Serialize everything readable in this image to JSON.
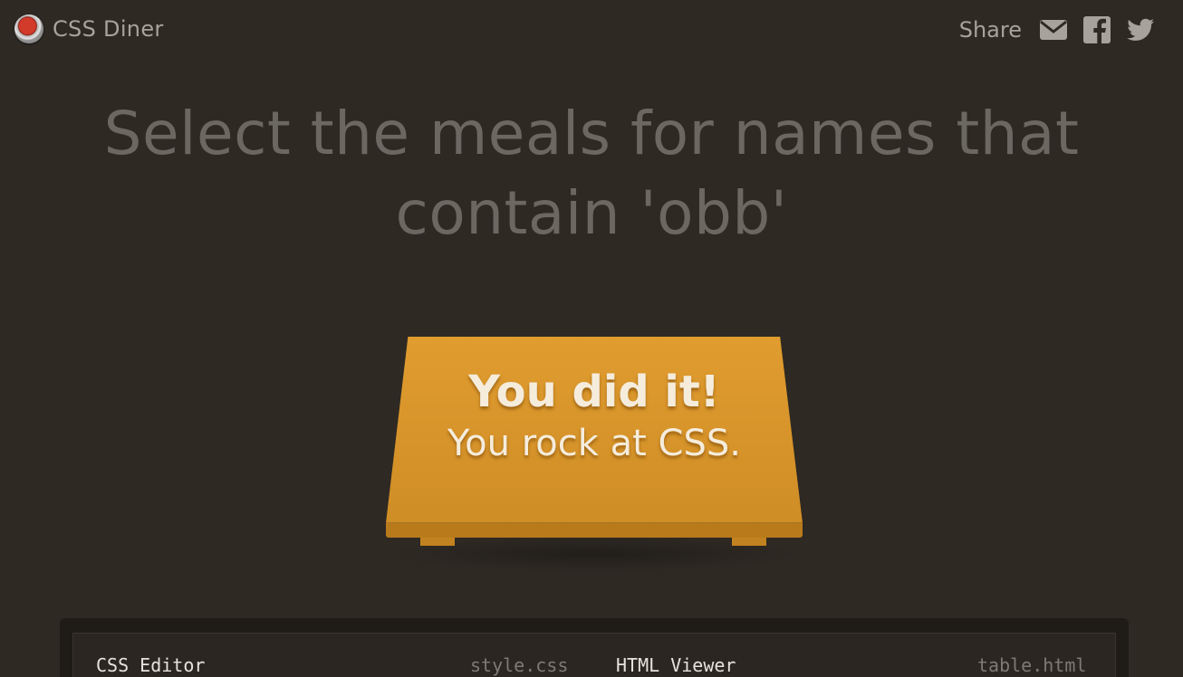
{
  "header": {
    "logo_text": "CSS Diner",
    "share_label": "Share",
    "share_icons": [
      "mail-icon",
      "facebook-icon",
      "twitter-icon"
    ]
  },
  "instruction": {
    "text": "Select the meals for names that contain 'obb'"
  },
  "table": {
    "message_title": "You did it!",
    "message_subtitle": "You rock at CSS."
  },
  "editor": {
    "css_title": "CSS Editor",
    "css_file": "style.css",
    "html_title": "HTML Viewer",
    "html_file": "table.html"
  },
  "colors": {
    "background": "#2e2923",
    "table": "#df9a2d",
    "instruction_text": "#6b6761",
    "header_text": "#a7a39c"
  }
}
